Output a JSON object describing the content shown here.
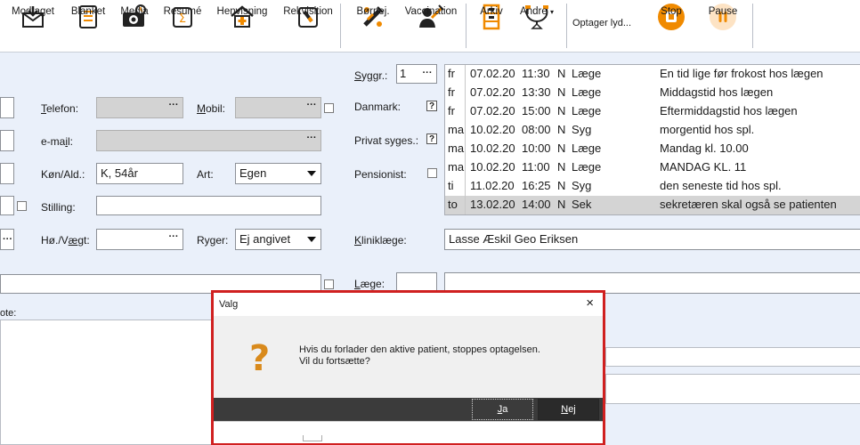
{
  "toolbar": {
    "buttons": [
      {
        "label": "Modtaget",
        "icon": "inbox-envelope-icon"
      },
      {
        "label": "Blanket",
        "icon": "form-document-icon"
      },
      {
        "label": "Media",
        "icon": "camera-icon"
      },
      {
        "label": "Resumé",
        "icon": "summary-sigma-icon"
      },
      {
        "label": "Henvisning",
        "icon": "referral-house-icon"
      },
      {
        "label": "Rekvisition",
        "icon": "requisition-tube-icon"
      },
      {
        "label": "Børnej.",
        "icon": "child-vaccine-icon"
      },
      {
        "label": "Vaccination",
        "icon": "vaccination-person-icon"
      },
      {
        "label": "Arkiv",
        "icon": "archive-cabinet-icon"
      },
      {
        "label": "Andre",
        "icon": "others-stethoscope-icon"
      },
      {
        "label": "Stop",
        "icon": "stop-icon"
      },
      {
        "label": "Pause",
        "icon": "pause-icon"
      }
    ],
    "status": "Optager lyd...",
    "accent": "#f08a00"
  },
  "form": {
    "telefon_label": "Telefon:",
    "mobil_label": "Mobil:",
    "email_label": "e-mail:",
    "kon_label": "Køn/Ald.:",
    "kon_value": "K, 54år",
    "art_label": "Art:",
    "art_value": "Egen",
    "stilling_label": "Stilling:",
    "hojde_label": "Hø./Vægt:",
    "ryger_label": "Ryger:",
    "ryger_value": "Ej angivet",
    "note_label": "ote:",
    "dots": "···"
  },
  "right": {
    "sygr_label": "Syggr.:",
    "sygr_value": "1",
    "danmark_label": "Danmark:",
    "privat_label": "Privat syges.:",
    "pensionist_label": "Pensionist:",
    "klinik_label": "Kliniklæge:",
    "klinik_value": "Lasse Æskil Geo Eriksen",
    "laege_label": "Læge:",
    "qmark": "?"
  },
  "appointments": [
    {
      "day": "fr",
      "date": "07.02.20",
      "time": "11:30",
      "flag": "N",
      "type": "Læge",
      "note": "En tid lige før frokost hos lægen"
    },
    {
      "day": "fr",
      "date": "07.02.20",
      "time": "13:30",
      "flag": "N",
      "type": "Læge",
      "note": "Middagstid hos lægen"
    },
    {
      "day": "fr",
      "date": "07.02.20",
      "time": "15:00",
      "flag": "N",
      "type": "Læge",
      "note": "Eftermiddagstid hos lægen"
    },
    {
      "day": "ma",
      "date": "10.02.20",
      "time": "08:00",
      "flag": "N",
      "type": "Syg",
      "note": "morgentid hos spl."
    },
    {
      "day": "ma",
      "date": "10.02.20",
      "time": "10:00",
      "flag": "N",
      "type": "Læge",
      "note": "Mandag kl. 10.00"
    },
    {
      "day": "ma",
      "date": "10.02.20",
      "time": "11:00",
      "flag": "N",
      "type": "Læge",
      "note": "MANDAG KL. 11"
    },
    {
      "day": "ti",
      "date": "11.02.20",
      "time": "16:25",
      "flag": "N",
      "type": "Syg",
      "note": "den seneste tid hos spl."
    },
    {
      "day": "to",
      "date": "13.02.20",
      "time": "14:00",
      "flag": "N",
      "type": "Sek",
      "note": "sekretæren skal også se patienten"
    }
  ],
  "dialog": {
    "title": "Valg",
    "close": "×",
    "icon": "question-icon",
    "icon_glyph": "?",
    "message_line1": "Hvis du forlader den aktive patient, stoppes optagelsen.",
    "message_line2": "Vil du fortsætte?",
    "yes_label_u": "J",
    "yes_label_rest": "a",
    "no_label_u": "N",
    "no_label_rest": "ej"
  }
}
